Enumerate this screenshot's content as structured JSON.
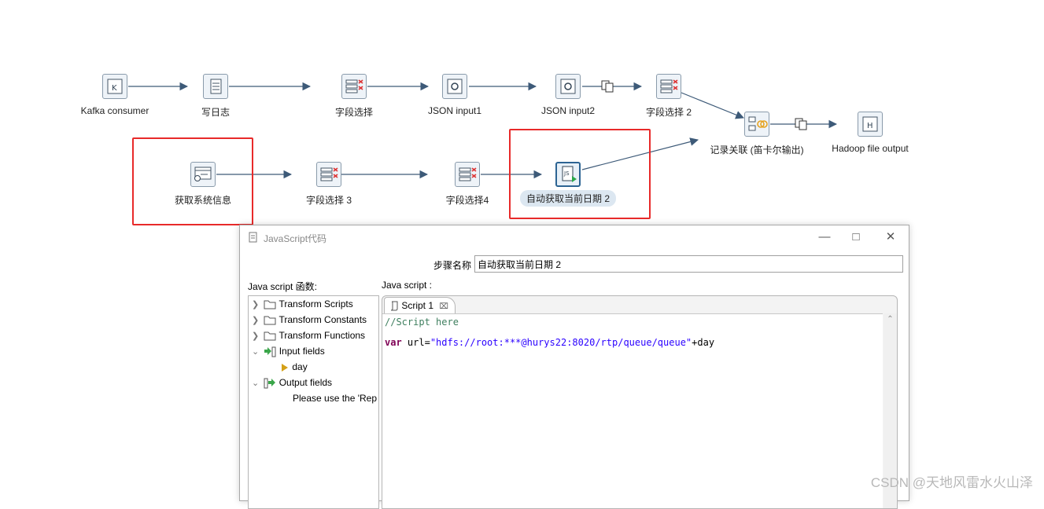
{
  "nodes": {
    "kafka": {
      "label": "Kafka consumer",
      "icon": "kafka-icon"
    },
    "write_log": {
      "label": "写日志",
      "icon": "log-icon"
    },
    "select1": {
      "label": "字段选择",
      "icon": "select-values-icon"
    },
    "json1": {
      "label": "JSON input1",
      "icon": "json-icon"
    },
    "json2": {
      "label": "JSON input2",
      "icon": "json-icon"
    },
    "select2": {
      "label": "字段选择 2",
      "icon": "select-values-icon"
    },
    "join": {
      "label": "记录关联 (笛卡尔输出)",
      "icon": "join-icon"
    },
    "hadoop": {
      "label": "Hadoop file output",
      "icon": "hadoop-icon"
    },
    "sysinfo": {
      "label": "获取系统信息",
      "icon": "system-info-icon"
    },
    "select3": {
      "label": "字段选择 3",
      "icon": "select-values-icon"
    },
    "select4": {
      "label": "字段选择4",
      "icon": "select-values-icon"
    },
    "js_step": {
      "label": "自动获取当前日期 2",
      "icon": "javascript-icon"
    }
  },
  "dialog": {
    "title": "JavaScript代码",
    "step_name_label": "步骤名称",
    "step_name_value": "自动获取当前日期 2",
    "functions_label": "Java script 函数:",
    "script_label": "Java script :",
    "tree": [
      {
        "label": "Transform Scripts",
        "icon": "folder-icon"
      },
      {
        "label": "Transform Constants",
        "icon": "folder-icon"
      },
      {
        "label": "Transform Functions",
        "icon": "folder-icon"
      },
      {
        "label": "Input fields",
        "icon": "input-fields-icon"
      },
      {
        "label": "day",
        "icon": "field-arrow-icon"
      },
      {
        "label": "Output fields",
        "icon": "output-fields-icon"
      },
      {
        "label": "Please use the 'Rep",
        "icon": ""
      }
    ],
    "tab_label": "Script 1",
    "code": {
      "line1": "//Script here",
      "line2_keyword": "var",
      "line2_pre": " url=",
      "line2_string": "\"hdfs://root:***@hurys22:8020/rtp/queue/queue\"",
      "line2_post": "+day"
    }
  },
  "watermark": "CSDN @天地风雷水火山泽",
  "colors": {
    "highlight_box": "#e82a2a",
    "hop_line": "#3d5a78",
    "selected_node": "#2c6493"
  }
}
